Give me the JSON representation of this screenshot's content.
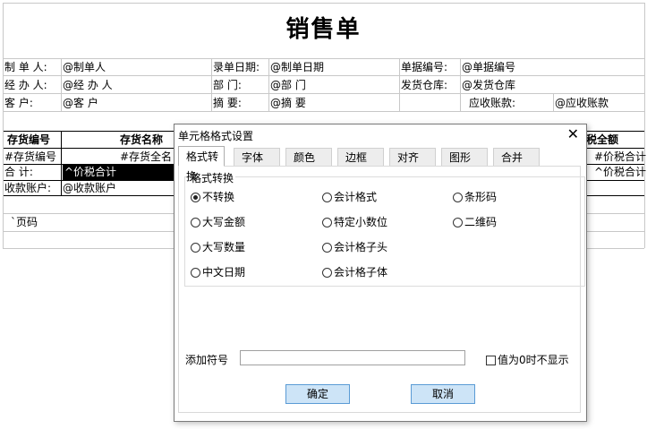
{
  "report": {
    "title": "销售单",
    "row1": {
      "l1": "制 单 人:",
      "v1": "@制单人",
      "l2": "录单日期:",
      "v2": "@制单日期",
      "l3": "单据编号:",
      "v3": "@单据编号"
    },
    "row2": {
      "l1": "经 办 人:",
      "v1": "@经 办 人",
      "l2": "部    门:",
      "v2": "@部    门",
      "l3": "发货仓库:",
      "v3": "@发货仓库"
    },
    "row3": {
      "l1": "客    户:",
      "v1": "@客    户",
      "l2": "摘    要:",
      "v2": "@摘    要",
      "l3": "应收账款:",
      "v3": "@应收账款"
    },
    "table": {
      "headers": [
        "存货编号",
        "存货名称",
        "税全额"
      ],
      "fields": [
        "#存货编号",
        "#存货全名",
        "#价税合计"
      ],
      "total_label": "合    计:",
      "total_value": "^价税合计",
      "total_right": "^价税合计",
      "account_label": "收款账户:",
      "account_value": "@收款账户",
      "page_code": "`页码"
    }
  },
  "dialog": {
    "title": "单元格格式设置",
    "close": "✕",
    "tabs": [
      "格式转换",
      "字体",
      "颜色",
      "边框",
      "对齐",
      "图形",
      "合并"
    ],
    "active_tab": 0,
    "group_label": "格式转换",
    "options": [
      {
        "label": "不转换",
        "checked": true
      },
      {
        "label": "会计格式",
        "checked": false
      },
      {
        "label": "条形码",
        "checked": false
      },
      {
        "label": "大写金额",
        "checked": false
      },
      {
        "label": "特定小数位",
        "checked": false
      },
      {
        "label": "二维码",
        "checked": false
      },
      {
        "label": "大写数量",
        "checked": false
      },
      {
        "label": "会计格子头",
        "checked": false
      },
      {
        "label": "中文日期",
        "checked": false
      },
      {
        "label": "会计格子体",
        "checked": false
      }
    ],
    "symbol_label": "添加符号",
    "symbol_value": "",
    "zero_hide_label": "值为0时不显示",
    "zero_hide_checked": false,
    "ok_label": "确定",
    "cancel_label": "取消"
  }
}
